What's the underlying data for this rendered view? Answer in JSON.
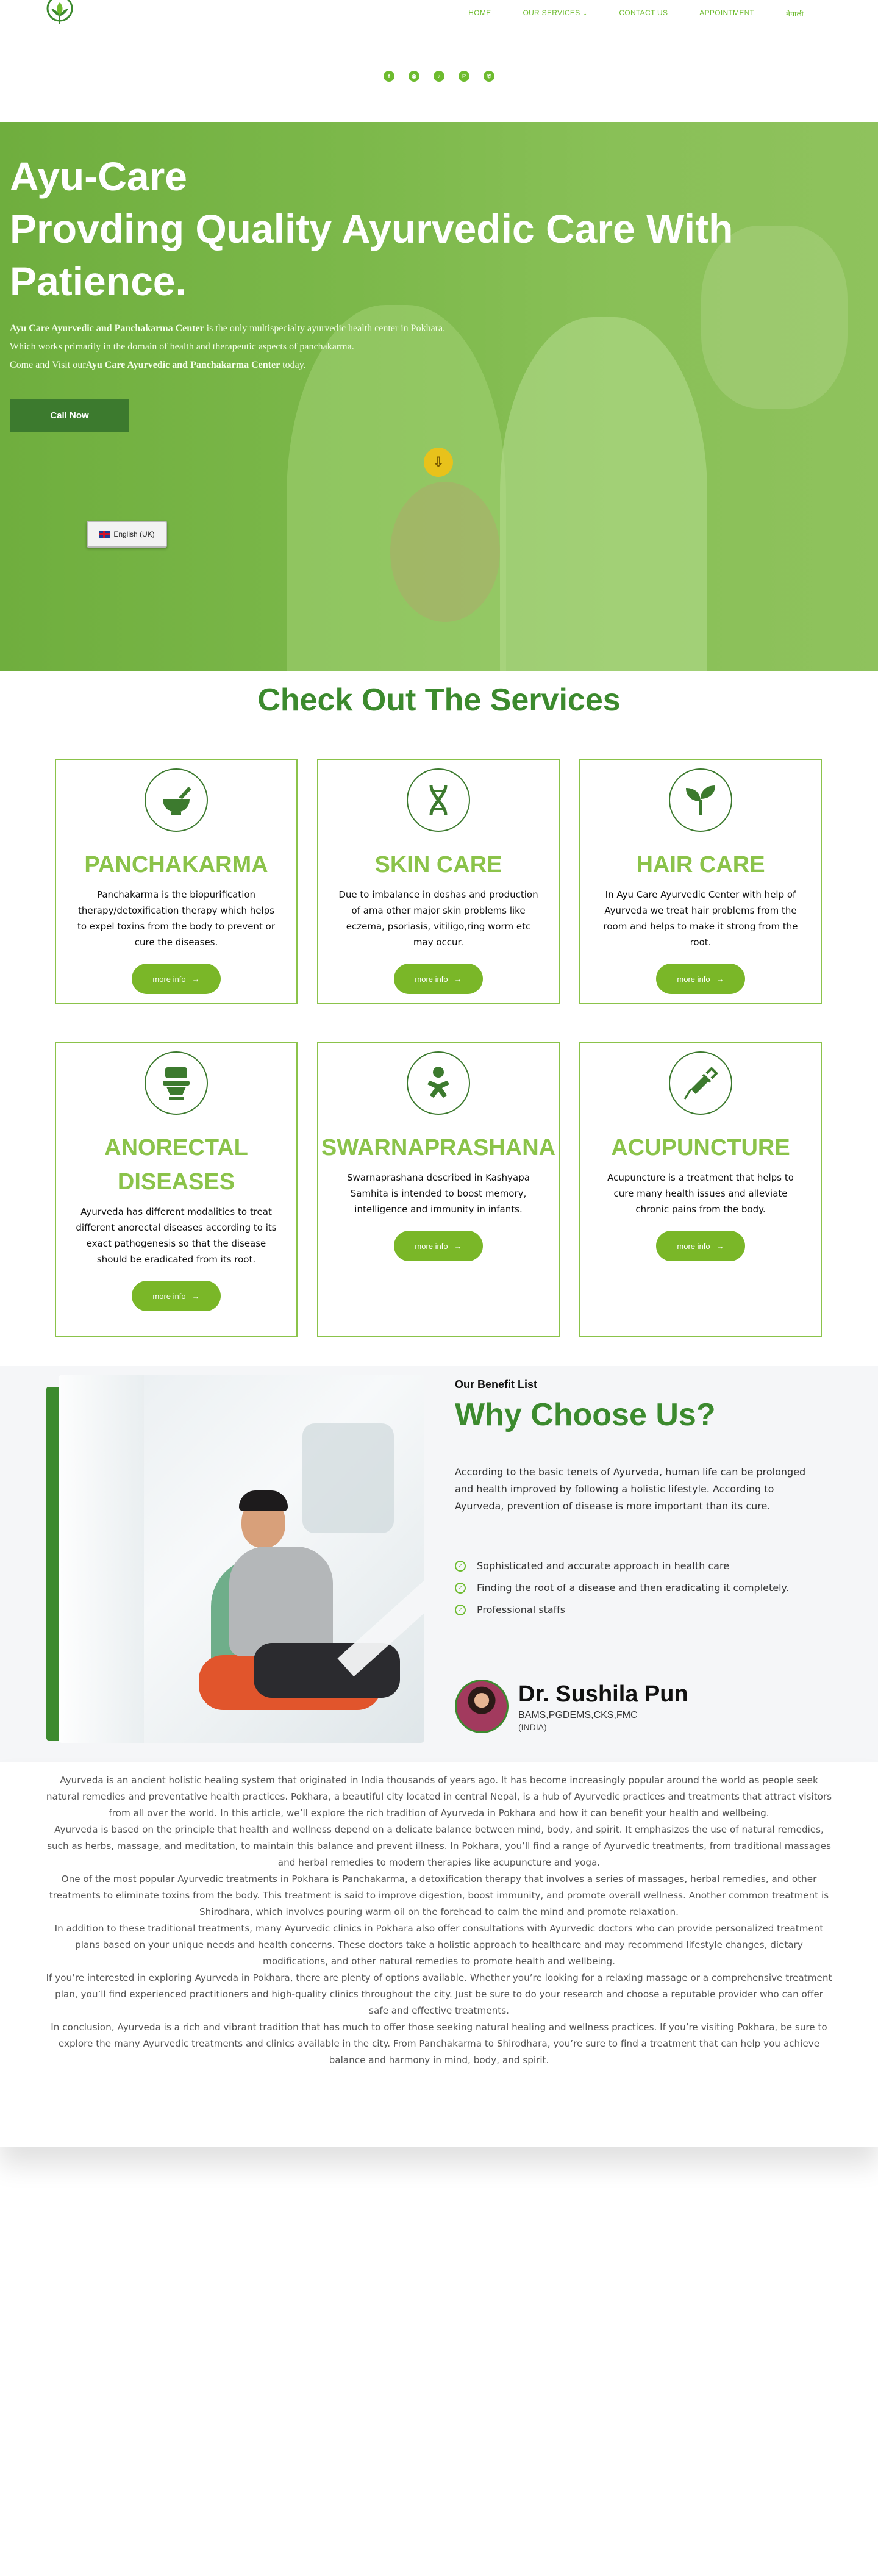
{
  "header": {
    "nav": [
      {
        "label": "HOME"
      },
      {
        "label": "OUR SERVICES",
        "has_dropdown": true
      },
      {
        "label": "CONTACT US"
      },
      {
        "label": "APPOINTMENT"
      },
      {
        "label": "नेपाली"
      }
    ],
    "social_icons": [
      "facebook-icon",
      "instagram-icon",
      "tiktok-icon",
      "pinterest-icon",
      "whatsapp-icon"
    ]
  },
  "hero": {
    "title_line1": "Ayu-Care",
    "title_line2": "Provding Quality Ayurvedic Care With",
    "title_line3": "Patience.",
    "desc1_bold": "Ayu Care Ayurvedic and Panchakarma Center",
    "desc1_rest": " is the only multispecialty ayurvedic health center in Pokhara.",
    "desc2": "Which works primarily in the domain of health and therapeutic aspects of panchakarma.",
    "desc3_pre": "Come and Visit our",
    "desc3_bold": "Ayu Care Ayurvedic and Panchakarma Center",
    "desc3_post": " today.",
    "cta": "Call Now",
    "language": "English (UK)"
  },
  "services": {
    "title": "Check Out The Services",
    "more_label": "more info",
    "cards": [
      {
        "title": "PANCHAKARMA",
        "icon": "mortar-pestle-icon",
        "text": "Panchakarma is the biopurification therapy/detoxification therapy which helps to expel toxins from the body to prevent or cure the diseases."
      },
      {
        "title": "SKIN CARE",
        "icon": "dna-icon",
        "text": "Due to imbalance in doshas and production of ama other major skin problems like eczema, psoriasis, vitiligo,ring worm etc may occur."
      },
      {
        "title": "HAIR CARE",
        "icon": "seedling-icon",
        "text": "In Ayu Care Ayurvedic Center with help of Ayurveda we treat hair problems from the room and helps to make it strong from the root."
      },
      {
        "title": "ANORECTAL DISEASES",
        "icon": "toilet-icon",
        "text": "Ayurveda has different modalities to treat different anorectal diseases according to its exact pathogenesis so that the disease should be eradicated from its root."
      },
      {
        "title": "SWARNAPRASHANA",
        "icon": "baby-icon",
        "text": "Swarnaprashana described in Kashyapa Samhita is intended to boost memory, intelligence and immunity in infants."
      },
      {
        "title": "ACUPUNCTURE",
        "icon": "syringe-icon",
        "text": "Acupuncture is a treatment that helps to cure many health issues and alleviate chronic pains from the body."
      }
    ]
  },
  "why": {
    "label": "Our Benefit List",
    "title": "Why Choose Us?",
    "text": "According to the basic tenets of Ayurveda, human life can be prolonged and health improved by following a holistic lifestyle. According to Ayurveda, prevention of disease is more important than its cure.",
    "list": [
      "Sophisticated and accurate approach in health care",
      "Finding the root of a disease and then eradicating it completely.",
      "Professional staffs"
    ],
    "doctor": {
      "name": "Dr. Sushila Pun",
      "credentials": "BAMS,PGDEMS,CKS,FMC",
      "country": "(INDIA)"
    }
  },
  "article": {
    "paragraphs": [
      "Ayurveda is an ancient holistic healing system that originated in India thousands of years ago. It has become increasingly popular around the world as people seek natural remedies and preventative health practices. Pokhara, a beautiful city located in central Nepal, is a hub of Ayurvedic practices and treatments that attract visitors from all over the world. In this article, we’ll explore the rich tradition of Ayurveda in Pokhara and how it can benefit your health and wellbeing.",
      "Ayurveda is based on the principle that health and wellness depend on a delicate balance between mind, body, and spirit. It emphasizes the use of natural remedies, such as herbs, massage, and meditation, to maintain this balance and prevent illness. In Pokhara, you’ll find a range of Ayurvedic treatments, from traditional massages and herbal remedies to modern therapies like acupuncture and yoga.",
      "One of the most popular Ayurvedic treatments in Pokhara is Panchakarma, a detoxification therapy that involves a series of massages, herbal remedies, and other treatments to eliminate toxins from the body. This treatment is said to improve digestion, boost immunity, and promote overall wellness. Another common treatment is Shirodhara, which involves pouring warm oil on the forehead to calm the mind and promote relaxation.",
      "In addition to these traditional treatments, many Ayurvedic clinics in Pokhara also offer consultations with Ayurvedic doctors who can provide personalized treatment plans based on your unique needs and health concerns. These doctors take a holistic approach to healthcare and may recommend lifestyle changes, dietary modifications, and other natural remedies to promote health and wellbeing.",
      "If you’re interested in exploring Ayurveda in Pokhara, there are plenty of options available. Whether you’re looking for a relaxing massage or a comprehensive treatment plan, you’ll find experienced practitioners and high-quality clinics throughout the city. Just be sure to do your research and choose a reputable provider who can offer safe and effective treatments.",
      "In conclusion, Ayurveda is a rich and vibrant tradition that has much to offer those seeking natural healing and wellness practices. If you’re visiting Pokhara, be sure to explore the many Ayurvedic treatments and clinics available in the city. From Panchakarma to Shirodhara, you’re sure to find a treatment that can help you achieve balance and harmony in mind, body, and spirit."
    ]
  },
  "colors": {
    "brand_green": "#3c8a2e",
    "accent_green": "#8bc34a",
    "button_green": "#7ab728",
    "scroll_yellow": "#e8c21b"
  }
}
